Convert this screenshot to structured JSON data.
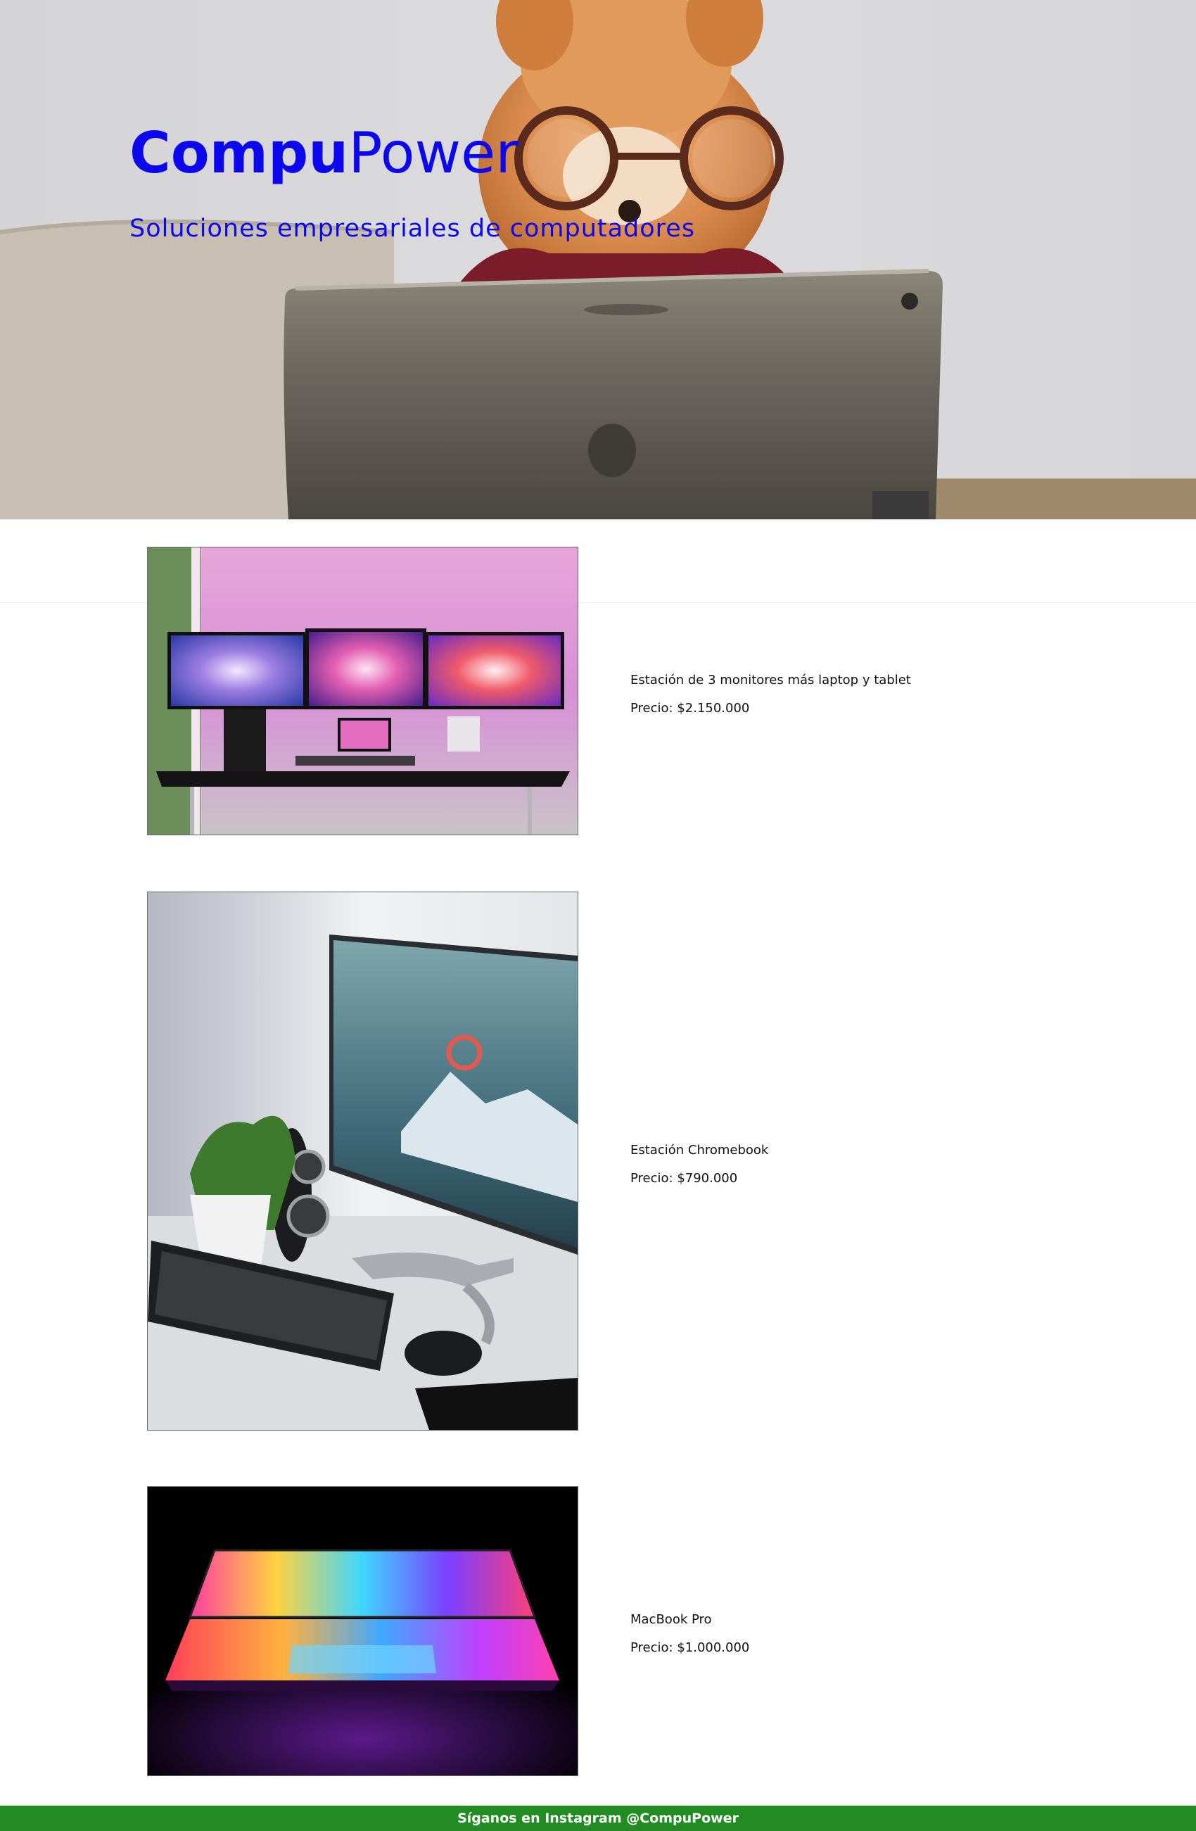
{
  "hero": {
    "brand_bold": "Compu",
    "brand_light": "Power",
    "tagline": "Soluciones empresariales de computadores",
    "image_icon": "dog-with-glasses-using-tablet-photo"
  },
  "products": [
    {
      "name": "Estación de 3 monitores más laptop y tablet",
      "price": "Precio: $2.150.000",
      "image_icon": "triple-monitor-desk-photo"
    },
    {
      "name": "Estación Chromebook",
      "price": "Precio: $790.000",
      "image_icon": "chromebook-workstation-photo"
    },
    {
      "name": "MacBook Pro",
      "price": "Precio: $1.000.000",
      "image_icon": "glowing-macbook-photo"
    }
  ],
  "footer": {
    "text": "Síganos en Instagram @CompuPower",
    "background_color": "#238b23"
  },
  "colors": {
    "brand_blue": "#0d07ee"
  }
}
